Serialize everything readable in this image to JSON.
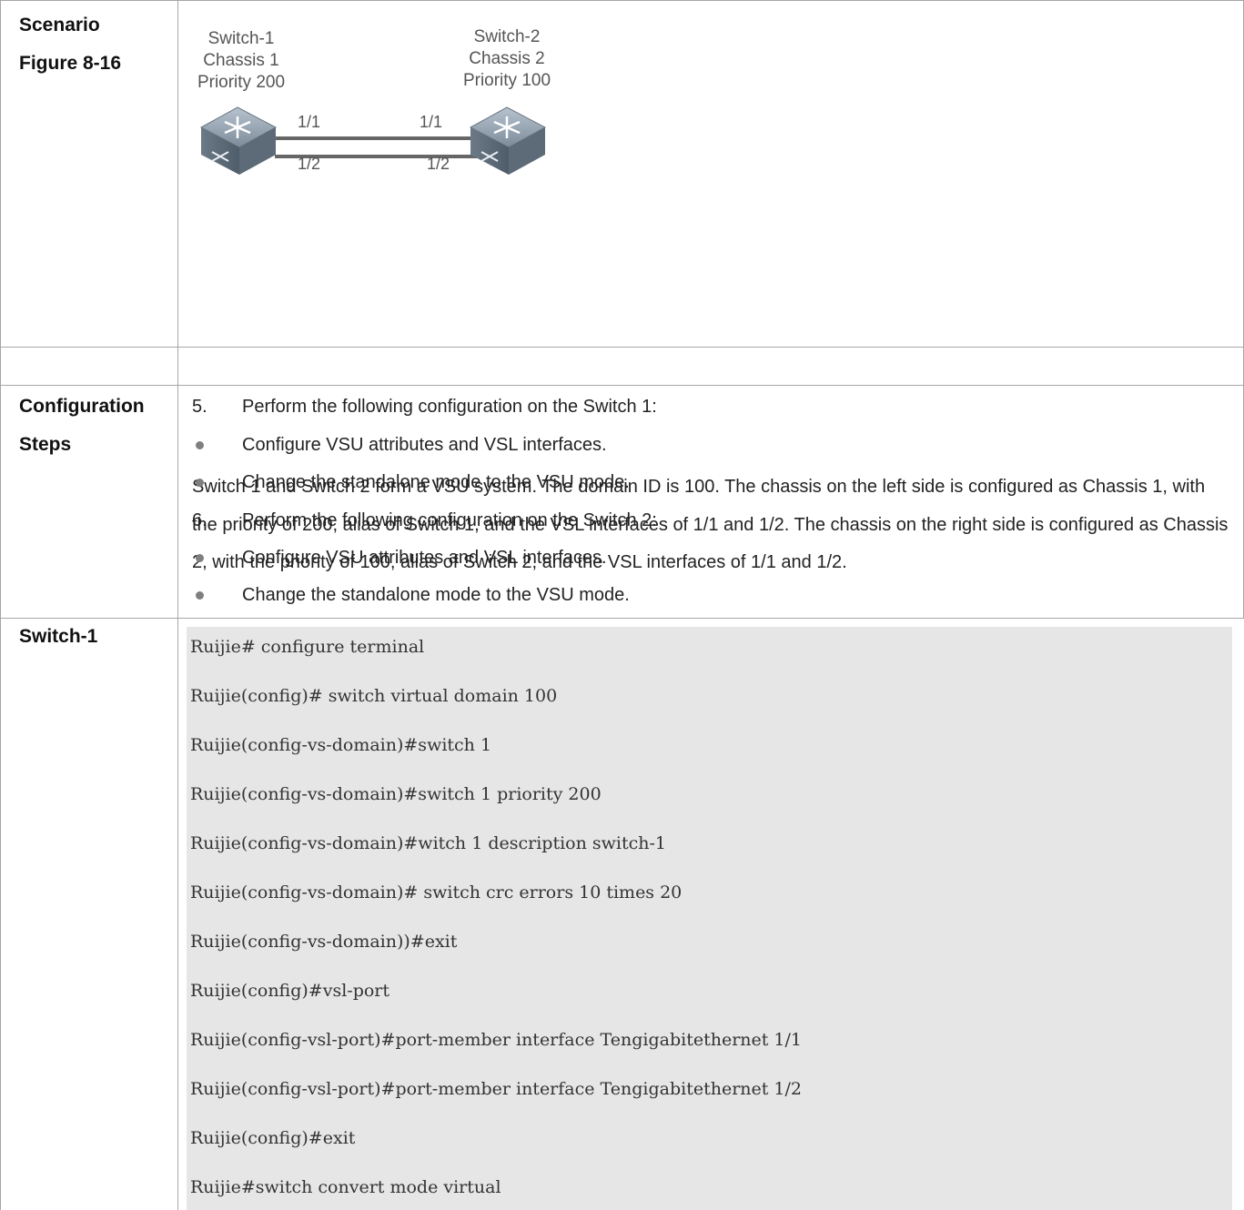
{
  "rows": {
    "scenario": {
      "label_line1": "Scenario",
      "label_line2": "Figure 8-16"
    },
    "config": {
      "label_line1": "Configuration",
      "label_line2": "Steps"
    },
    "switch1": {
      "label": "Switch-1"
    }
  },
  "figure": {
    "switch_left": {
      "name": "Switch-1",
      "chassis": "Chassis 1",
      "priority": "Priority 200"
    },
    "switch_right": {
      "name": "Switch-2",
      "chassis": "Chassis 2",
      "priority": "Priority 100"
    },
    "ports": {
      "left_top": "1/1",
      "left_bottom": "1/2",
      "right_top": "1/1",
      "right_bottom": "1/2"
    }
  },
  "description": "Switch 1 and Switch 2 form a VSU system. The domain ID is 100. The chassis on the left side is configured as Chassis 1, with the priority of 200, alias of Switch 1, and the VSL interfaces of 1/1 and 1/2. The chassis on the right side is configured as Chassis 2, with the priority of 100, alias of Switch 2, and the VSL interfaces of 1/1 and 1/2.",
  "steps": [
    {
      "marker": "5.",
      "text": "Perform the following configuration on the Switch 1:"
    },
    {
      "marker": "",
      "text": "Configure VSU attributes and VSL interfaces."
    },
    {
      "marker": "",
      "text": "Change the standalone mode to the VSU mode."
    },
    {
      "marker": "6.",
      "text": "Perform the following configuration on the Switch 2:"
    },
    {
      "marker": "",
      "text": "Configure VSU attributes and VSL interfaces."
    },
    {
      "marker": "",
      "text": "Change the standalone mode to the VSU mode."
    }
  ],
  "code": [
    "Ruijie# configure terminal",
    "Ruijie(config)# switch virtual domain 100",
    "Ruijie(config-vs-domain)#switch 1",
    "Ruijie(config-vs-domain)#switch 1 priority 200",
    "Ruijie(config-vs-domain)#witch 1 description switch-1",
    "Ruijie(config-vs-domain)# switch crc errors 10 times 20",
    "Ruijie(config-vs-domain))#exit",
    "Ruijie(config)#vsl-port",
    "Ruijie(config-vsl-port)#port-member interface Tengigabitethernet 1/1",
    "Ruijie(config-vsl-port)#port-member interface Tengigabitethernet 1/2",
    "Ruijie(config)#exit",
    "Ruijie#switch convert mode virtual"
  ]
}
